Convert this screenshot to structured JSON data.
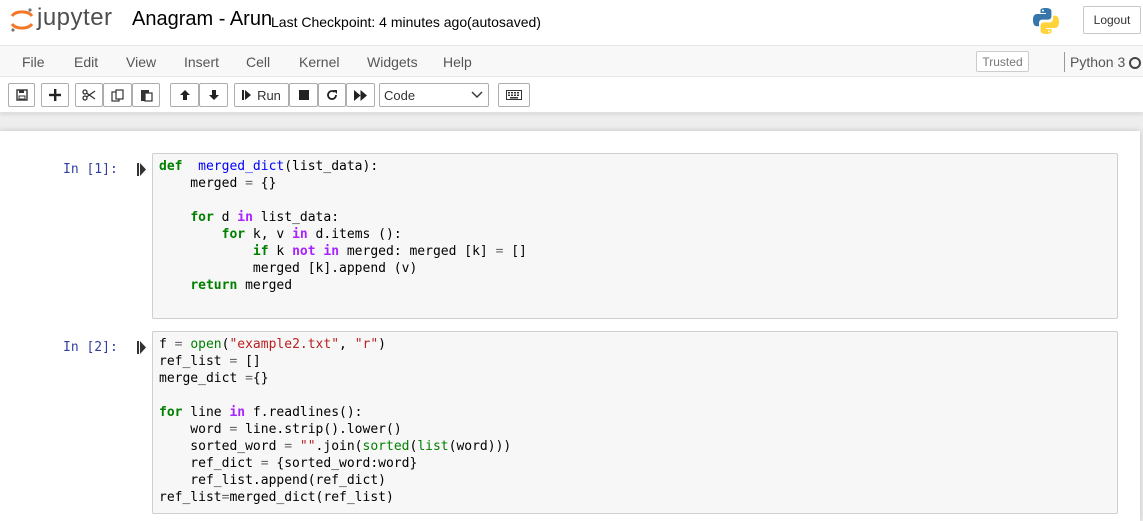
{
  "header": {
    "logo_text": "jupyter",
    "notebook_name": "Anagram - Arun",
    "checkpoint": "Last Checkpoint: 4 minutes ago",
    "autosave_status": "(autosaved)",
    "logout_label": "Logout"
  },
  "menu": {
    "items": [
      "File",
      "Edit",
      "View",
      "Insert",
      "Cell",
      "Kernel",
      "Widgets",
      "Help"
    ],
    "trusted_label": "Trusted",
    "kernel_name": "Python 3"
  },
  "toolbar": {
    "run_label": "Run",
    "cell_type": "Code"
  },
  "cells": [
    {
      "prompt": "In [1]:",
      "lines": [
        [
          [
            "kw",
            "def"
          ],
          [
            "",
            "  "
          ],
          [
            "fn",
            "merged_dict"
          ],
          [
            "",
            "(list_data):"
          ]
        ],
        [
          [
            "",
            "    merged "
          ],
          [
            "opn",
            "="
          ],
          [
            "",
            " {}"
          ]
        ],
        [
          [
            "",
            ""
          ]
        ],
        [
          [
            "",
            "    "
          ],
          [
            "kw",
            "for"
          ],
          [
            "",
            " d "
          ],
          [
            "op",
            "in"
          ],
          [
            "",
            " list_data:"
          ]
        ],
        [
          [
            "",
            "        "
          ],
          [
            "kw",
            "for"
          ],
          [
            "",
            " k, v "
          ],
          [
            "op",
            "in"
          ],
          [
            "",
            " d.items ():"
          ]
        ],
        [
          [
            "",
            "            "
          ],
          [
            "kw",
            "if"
          ],
          [
            "",
            " k "
          ],
          [
            "op",
            "not"
          ],
          [
            "",
            " "
          ],
          [
            "op",
            "in"
          ],
          [
            "",
            " merged: merged [k] "
          ],
          [
            "opn",
            "="
          ],
          [
            "",
            " []"
          ]
        ],
        [
          [
            "",
            "            merged [k].append (v)"
          ]
        ],
        [
          [
            "",
            "    "
          ],
          [
            "kw",
            "return"
          ],
          [
            "",
            " merged"
          ]
        ]
      ]
    },
    {
      "prompt": "In [2]:",
      "lines": [
        [
          [
            "",
            "f "
          ],
          [
            "opn",
            "="
          ],
          [
            "",
            " "
          ],
          [
            "bi",
            "open"
          ],
          [
            "",
            "("
          ],
          [
            "str",
            "\"example2.txt\""
          ],
          [
            "",
            ", "
          ],
          [
            "str",
            "\"r\""
          ],
          [
            "",
            ")"
          ]
        ],
        [
          [
            "",
            "ref_list "
          ],
          [
            "opn",
            "="
          ],
          [
            "",
            " []"
          ]
        ],
        [
          [
            "",
            "merge_dict "
          ],
          [
            "opn",
            "="
          ],
          [
            "",
            "{}"
          ]
        ],
        [
          [
            "",
            ""
          ]
        ],
        [
          [
            "kw",
            "for"
          ],
          [
            "",
            " line "
          ],
          [
            "op",
            "in"
          ],
          [
            "",
            " f.readlines():"
          ]
        ],
        [
          [
            "",
            "    word "
          ],
          [
            "opn",
            "="
          ],
          [
            "",
            " line.strip().lower()"
          ]
        ],
        [
          [
            "",
            "    sorted_word "
          ],
          [
            "opn",
            "="
          ],
          [
            "",
            " "
          ],
          [
            "str",
            "\"\""
          ],
          [
            "",
            ".join("
          ],
          [
            "bi",
            "sorted"
          ],
          [
            "",
            "("
          ],
          [
            "bi",
            "list"
          ],
          [
            "",
            "(word)))"
          ]
        ],
        [
          [
            "",
            "    ref_dict "
          ],
          [
            "opn",
            "="
          ],
          [
            "",
            " {sorted_word:word}"
          ]
        ],
        [
          [
            "",
            "    ref_list.append(ref_dict)"
          ]
        ],
        [
          [
            "",
            "ref_list"
          ],
          [
            "opn",
            "="
          ],
          [
            "",
            "merged_dict(ref_list)"
          ]
        ]
      ]
    }
  ]
}
